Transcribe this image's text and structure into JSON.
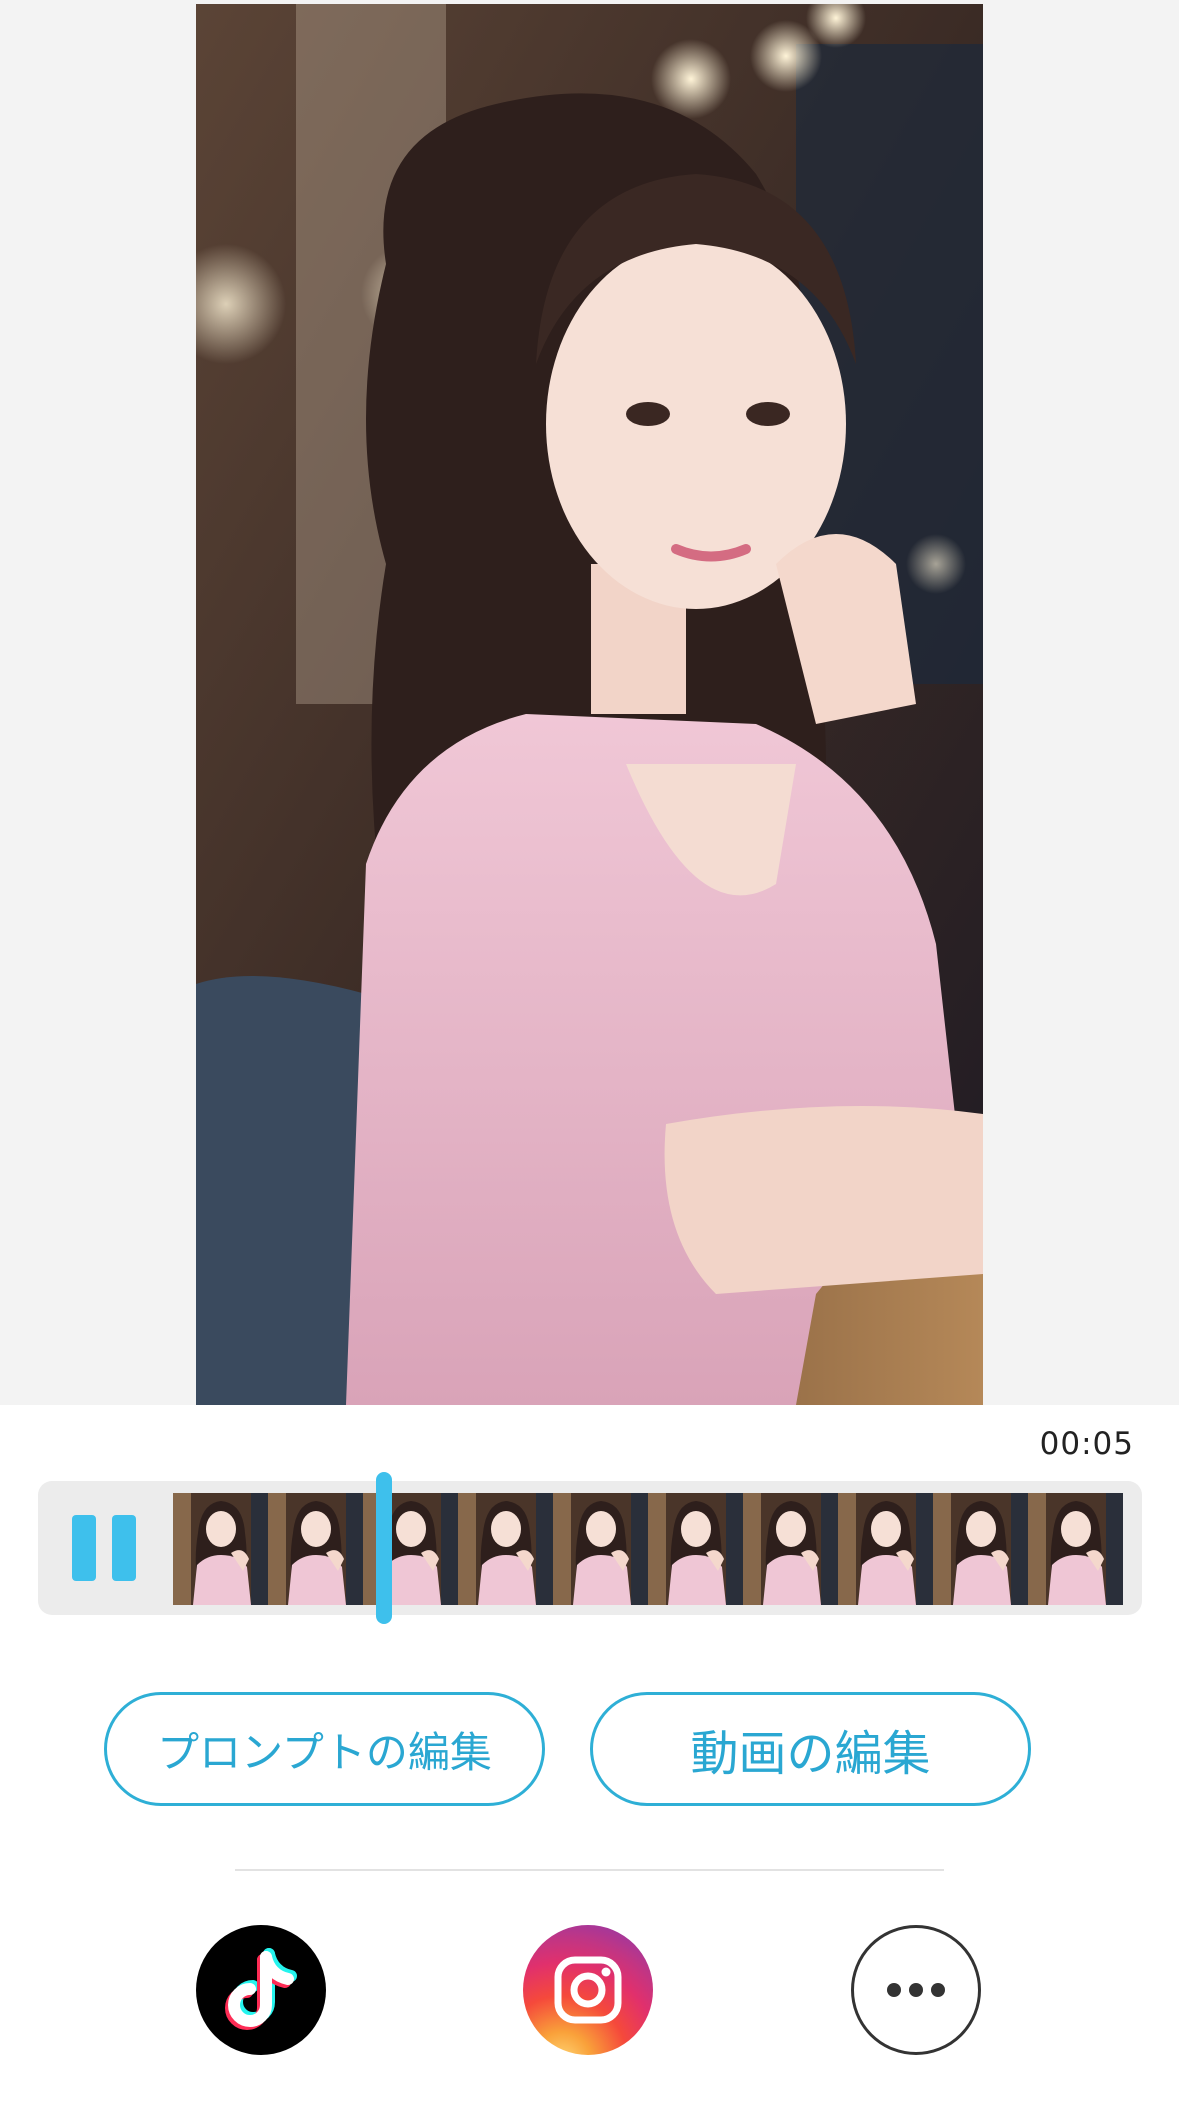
{
  "player": {
    "current_time": "00:05",
    "state": "playing",
    "timeline_frame_count": 10,
    "progress_fraction": 0.26
  },
  "actions": {
    "edit_prompt_label": "プロンプトの編集",
    "edit_video_label": "動画の編集"
  },
  "share": [
    {
      "name": "TikTok",
      "icon": "tiktok-icon"
    },
    {
      "name": "Instagram",
      "icon": "instagram-icon"
    },
    {
      "name": "More",
      "icon": "more-icon"
    }
  ],
  "colors": {
    "accent": "#3ec0ec",
    "button_border": "#2eafd6",
    "button_text": "#2aa7d2",
    "stage_background": "#f3f3f3"
  }
}
